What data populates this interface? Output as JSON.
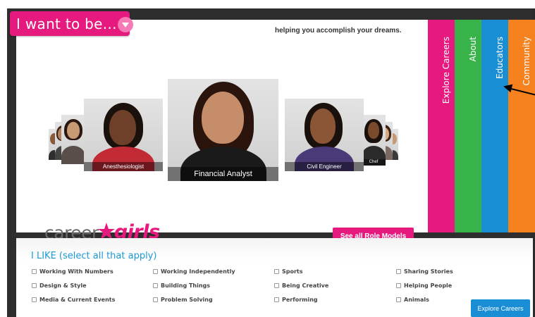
{
  "header": {
    "dropdown_label": "I want to be...",
    "tagline": "helping you accomplish your dreams."
  },
  "carousel": {
    "featured": "Financial Analyst",
    "left_1": "Anesthesiologist",
    "right_1": "Civil Engineer",
    "right_2": "Chef"
  },
  "brand": {
    "career": "career",
    "girls": "girls"
  },
  "actions": {
    "see_all": "See all Role Models"
  },
  "tabs": [
    {
      "label": "Explore Careers",
      "color": "#e6197e"
    },
    {
      "label": "About",
      "color": "#37b34a"
    },
    {
      "label": "Educators",
      "color": "#1a8ed4"
    },
    {
      "label": "Community",
      "color": "#f5821f"
    }
  ],
  "likes": {
    "title": "I LIKE (select all that apply)",
    "options": [
      "Working With Numbers",
      "Working Independently",
      "Sports",
      "Sharing Stories",
      "Design & Style",
      "Building Things",
      "Being Creative",
      "Helping People",
      "Media & Current Events",
      "Problem Solving",
      "Performing",
      "Animals"
    ],
    "explore_button": "Explore Careers"
  }
}
